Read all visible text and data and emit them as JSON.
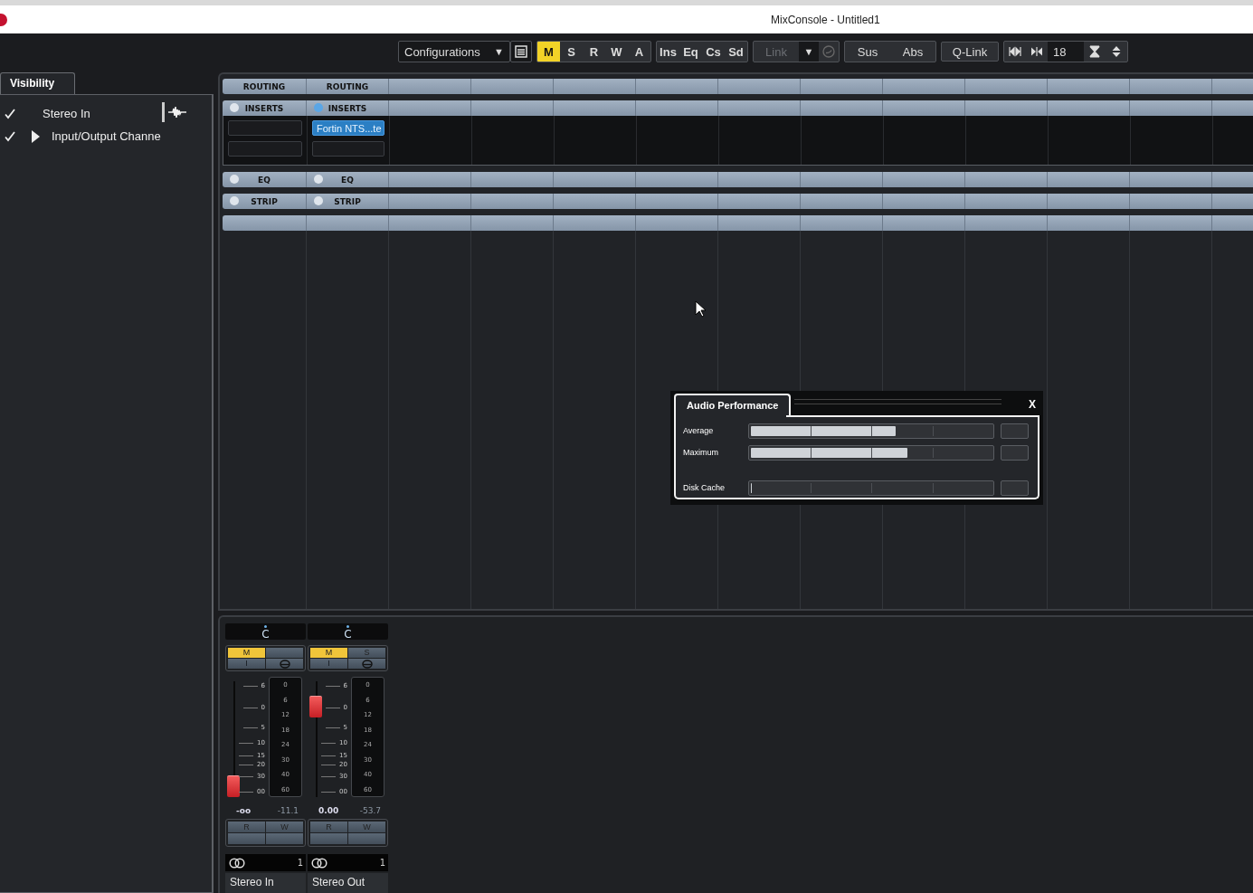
{
  "window": {
    "title": "MixConsole - Untitled1"
  },
  "toolbar": {
    "configurations": {
      "label": "Configurations",
      "arrow": "▼"
    },
    "view_buttons": [
      {
        "label": "M",
        "selected": true
      },
      {
        "label": "S",
        "selected": false
      },
      {
        "label": "R",
        "selected": false
      },
      {
        "label": "W",
        "selected": false
      },
      {
        "label": "A",
        "selected": false
      }
    ],
    "rack_buttons": [
      "Ins",
      "Eq",
      "Cs",
      "Sd"
    ],
    "link": {
      "label": "Link",
      "arrow": "▼",
      "disabled": true
    },
    "mode_buttons": [
      "Sus",
      "Abs"
    ],
    "qlink": "Q-Link",
    "width_value": "18"
  },
  "visibility": {
    "tab": "Visibility",
    "items": [
      {
        "label": "Stereo In",
        "checked": true,
        "kind": "channel"
      },
      {
        "label": "Input/Output Channe",
        "checked": true,
        "kind": "folder",
        "expanded": false
      }
    ]
  },
  "rack": {
    "channels": [
      {
        "routing": "ROUTING",
        "inserts": {
          "label": "INSERTS",
          "on": false
        },
        "eq": {
          "label": "EQ",
          "on": false
        },
        "strip": {
          "label": "STRIP",
          "on": false
        }
      },
      {
        "routing": "ROUTING",
        "inserts": {
          "label": "INSERTS",
          "on": true
        },
        "slots": [
          "Fortin NTS...te"
        ],
        "eq": {
          "label": "EQ",
          "on": false
        },
        "strip": {
          "label": "STRIP",
          "on": false
        }
      }
    ]
  },
  "channels": [
    {
      "pan": "C",
      "mute": {
        "label": "M",
        "on": true
      },
      "listen": "I",
      "level": 0,
      "fader_scale": [
        "6",
        "0",
        "5",
        "10",
        "15",
        "20",
        "30",
        "00"
      ],
      "meter_scale": [
        "0",
        "6",
        "12",
        "18",
        "24",
        "30",
        "40",
        "60"
      ],
      "volume": "-oo",
      "peak": "-11.1",
      "read": "R",
      "write": "W",
      "number": "1",
      "name": "Stereo In"
    },
    {
      "pan": "C",
      "mute": {
        "label": "M",
        "on": true
      },
      "solo": "S",
      "listen": "I",
      "level": 0.85,
      "fader_scale": [
        "6",
        "0",
        "5",
        "10",
        "15",
        "20",
        "30",
        "00"
      ],
      "meter_scale": [
        "0",
        "6",
        "12",
        "18",
        "24",
        "30",
        "40",
        "60"
      ],
      "volume": "0.00",
      "peak": "-53.7",
      "read": "R",
      "write": "W",
      "number": "1",
      "name": "Stereo Out"
    }
  ],
  "audio_performance": {
    "title": "Audio Performance",
    "close": "X",
    "meters": [
      {
        "label": "Average",
        "level": 0.6
      },
      {
        "label": "Maximum",
        "level": 0.65
      },
      {
        "label": "Disk Cache",
        "level": 0.005
      }
    ]
  }
}
